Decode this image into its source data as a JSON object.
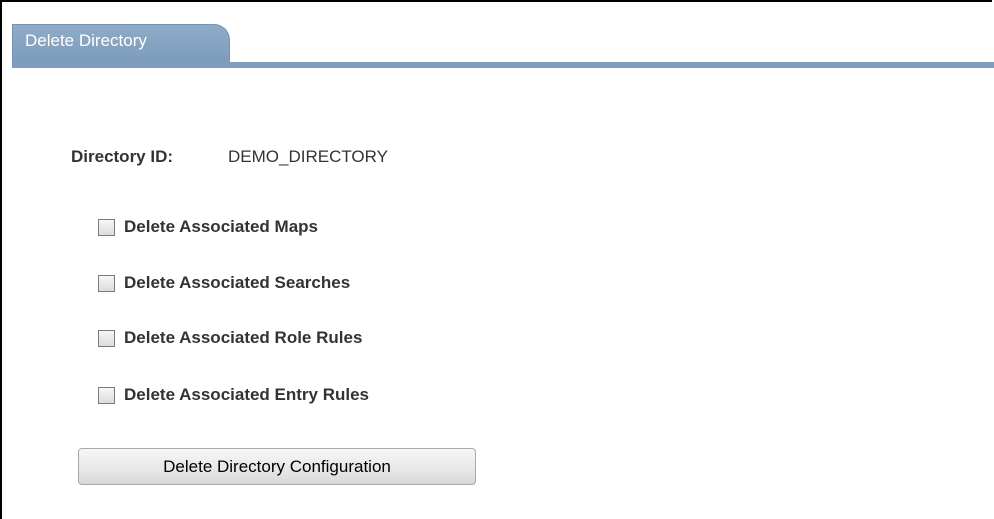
{
  "tabs": [
    {
      "label": "Delete Directory",
      "active": true
    }
  ],
  "form": {
    "directory_id_label": "Directory ID:",
    "directory_id_value": "DEMO_DIRECTORY",
    "options": [
      {
        "label": "Delete Associated Maps",
        "checked": false
      },
      {
        "label": "Delete Associated Searches",
        "checked": false
      },
      {
        "label": "Delete Associated Role Rules",
        "checked": false
      },
      {
        "label": "Delete Associated Entry Rules",
        "checked": false
      }
    ],
    "submit_label": "Delete Directory Configuration"
  },
  "colors": {
    "tab_background": "#8fabc7",
    "tab_rule": "#7f9ebd",
    "text": "#333333"
  }
}
